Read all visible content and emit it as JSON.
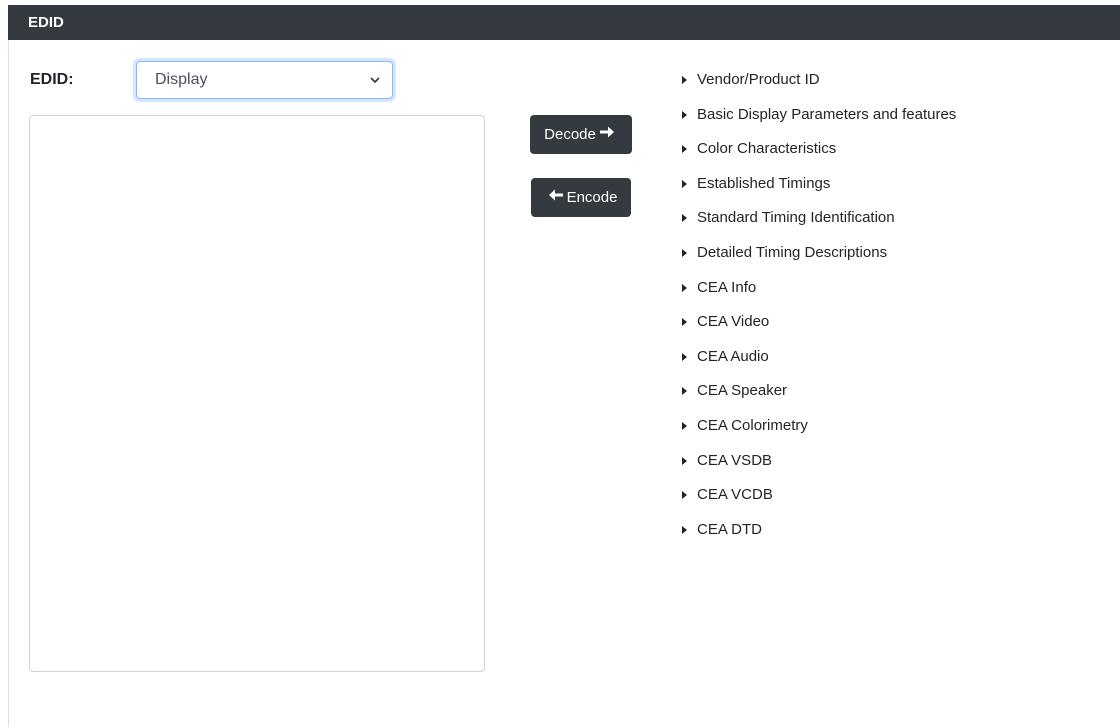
{
  "header": {
    "title": "EDID"
  },
  "edid_form": {
    "label": "EDID:",
    "select_value": "Display",
    "textarea_value": ""
  },
  "buttons": {
    "decode_label": "Decode",
    "encode_label": "Encode"
  },
  "sections": [
    {
      "label": "Vendor/Product ID"
    },
    {
      "label": "Basic Display Parameters and features"
    },
    {
      "label": "Color Characteristics"
    },
    {
      "label": "Established Timings"
    },
    {
      "label": "Standard Timing Identification"
    },
    {
      "label": "Detailed Timing Descriptions"
    },
    {
      "label": "CEA Info"
    },
    {
      "label": "CEA Video"
    },
    {
      "label": "CEA Audio"
    },
    {
      "label": "CEA Speaker"
    },
    {
      "label": "CEA Colorimetry"
    },
    {
      "label": "CEA VSDB"
    },
    {
      "label": "CEA VCDB"
    },
    {
      "label": "CEA DTD"
    }
  ],
  "colors": {
    "header_bg": "#343a40",
    "button_bg": "#343a40",
    "select_focus": "#86b7fe"
  },
  "icons": [
    "chevron-down-icon",
    "arrow-right-icon",
    "arrow-left-icon",
    "caret-right-icon"
  ]
}
